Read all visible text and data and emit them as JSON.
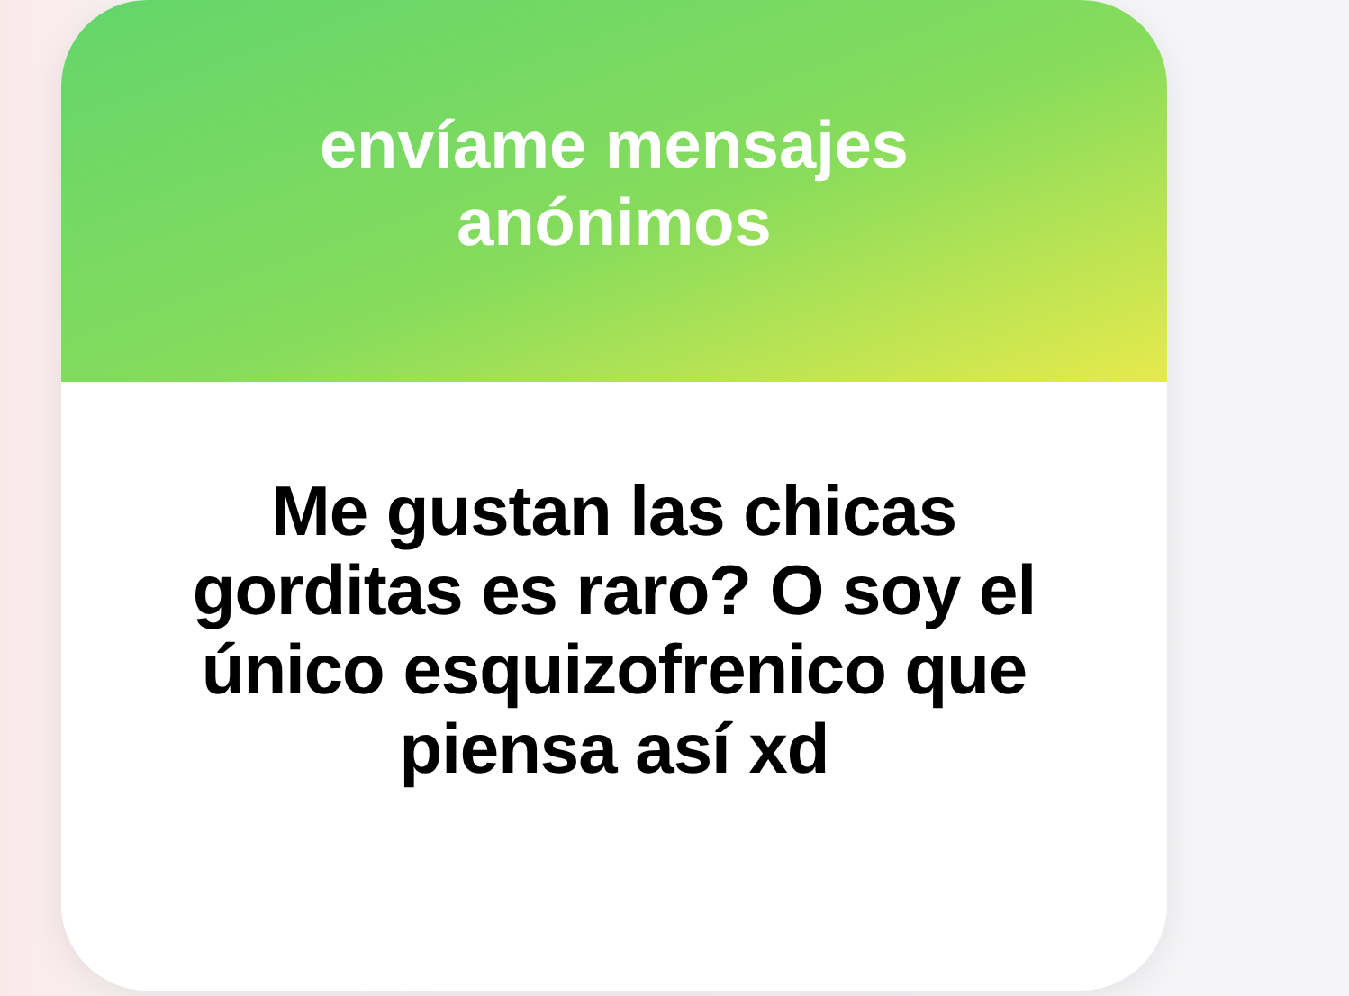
{
  "card": {
    "header": "envíame mensajes anónimos",
    "message": "Me gustan las chicas gorditas es raro? O soy el único esquizofrenico que piensa así xd"
  }
}
